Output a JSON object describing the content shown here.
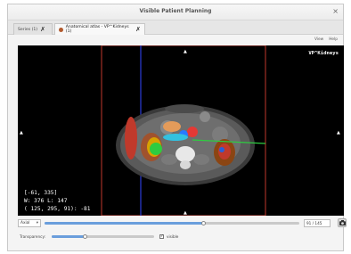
{
  "window": {
    "title": "Visible Patient Planning",
    "close_glyph": "×"
  },
  "tabs": [
    {
      "label": "Series (1)",
      "close_glyph": "✗",
      "active": false
    },
    {
      "label": "Anatomical atlas - VP^Kidneys (1)",
      "close_glyph": "✗",
      "active": true
    }
  ],
  "menus": [
    {
      "label": "View"
    },
    {
      "label": "Help"
    }
  ],
  "viewer": {
    "study_label": "VP^Kidneys",
    "marker_glyph": "▲",
    "info_lines": [
      "[-61, 335]",
      "W: 376 L: 147",
      "( 125, 295,  91): -81"
    ],
    "colors": {
      "background": "#000000",
      "frame": "#c0392b",
      "vertical_line": "#2b3bd6",
      "crosshair_green": "#2ecc40"
    }
  },
  "slice": {
    "orientation": "Axial",
    "current": 91,
    "total": 145,
    "display": "91 / 145",
    "slider_fraction": 0.627
  },
  "transparency": {
    "label": "Transparency:",
    "slider_fraction": 0.33,
    "visible_label": "visible",
    "visible_checked": true,
    "check_glyph": "✓"
  },
  "icons": {
    "camera": "camera-icon",
    "dropdown": "chevron-down-icon",
    "close": "close-icon"
  }
}
